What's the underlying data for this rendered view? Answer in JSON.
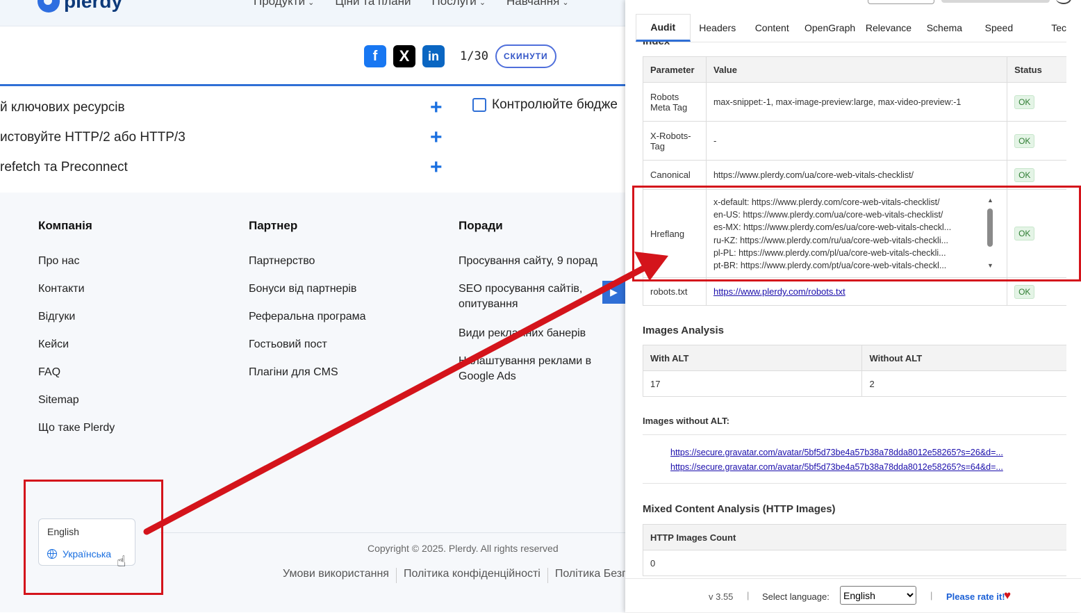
{
  "site": {
    "logo_text": "plerdy",
    "nav": [
      "Продукти",
      "Ціни та плани",
      "Послуги",
      "Навчання"
    ],
    "share": {
      "counter": "1/30",
      "reset_label": "СКИНУТИ",
      "fb_icon": "f",
      "x_icon": "X",
      "li_icon": "in"
    },
    "checklist": [
      "й ключових ресурсів",
      "истовуйте HTTP/2 або HTTP/3",
      "refetch та Preconnect"
    ],
    "checklist_right": "Контролюйте бюдже",
    "footer": {
      "columns": [
        {
          "title": "Компанія",
          "links": [
            "Про нас",
            "Контакти",
            "Відгуки",
            "Кейси",
            "FAQ",
            "Sitemap",
            "Що таке Plerdy"
          ]
        },
        {
          "title": "Партнер",
          "links": [
            "Партнерство",
            "Бонуси від партнерів",
            "Реферальна програма",
            "Гостьовий пост",
            "Плагіни для CMS"
          ]
        },
        {
          "title": "Поради",
          "links": [
            "Просування сайту, 9 порад",
            "SEO просування сайтів, опитування",
            "Види рекламних банерів",
            "Налаштування реклами в Google Ads"
          ]
        }
      ],
      "lang_options": [
        "English",
        "Українська"
      ],
      "copyright": "Copyright © 2025. Plerdy. All rights reserved",
      "legal": [
        "Умови використання",
        "Політика конфіденційності",
        "Політика Безп"
      ]
    }
  },
  "panel": {
    "tabs": [
      "Audit",
      "Headers",
      "Content",
      "OpenGraph",
      "Relevance",
      "Schema",
      "Speed",
      "Tec"
    ],
    "active_tab": "Audit",
    "clipped_heading": "Index",
    "index_table": {
      "headers": [
        "Parameter",
        "Value",
        "Status"
      ],
      "rows": [
        {
          "param": "Robots Meta Tag",
          "value": "max-snippet:-1, max-image-preview:large, max-video-preview:-1",
          "status": "OK"
        },
        {
          "param": "X-Robots-Tag",
          "value": "-",
          "status": "OK"
        },
        {
          "param": "Canonical",
          "value": "https://www.plerdy.com/ua/core-web-vitals-checklist/",
          "status": "OK"
        },
        {
          "param": "Hreflang",
          "values": [
            "x-default: https://www.plerdy.com/core-web-vitals-checklist/",
            "en-US: https://www.plerdy.com/ua/core-web-vitals-checklist/",
            "es-MX: https://www.plerdy.com/es/ua/core-web-vitals-checkl...",
            "ru-KZ: https://www.plerdy.com/ru/ua/core-web-vitals-checkli...",
            "pl-PL: https://www.plerdy.com/pl/ua/core-web-vitals-checkli...",
            "pt-BR: https://www.plerdy.com/pt/ua/core-web-vitals-checkl..."
          ],
          "status": "OK"
        },
        {
          "param": "robots.txt",
          "value": "https://www.plerdy.com/robots.txt",
          "status": "OK"
        }
      ]
    },
    "images": {
      "title": "Images Analysis",
      "headers": [
        "With ALT",
        "Without ALT"
      ],
      "values": [
        "17",
        "2"
      ],
      "without_alt_title": "Images without ALT:",
      "without_alt_links": [
        "https://secure.gravatar.com/avatar/5bf5d73be4a57b38a78dda8012e58265?s=26&d=...",
        "https://secure.gravatar.com/avatar/5bf5d73be4a57b38a78dda8012e58265?s=64&d=..."
      ]
    },
    "mixed": {
      "title": "Mixed Content Analysis (HTTP Images)",
      "header": "HTTP Images Count",
      "value": "0"
    },
    "footer": {
      "version": "v 3.55",
      "sep": "|",
      "lang_label": "Select language:",
      "lang_value": "English",
      "rate": "Please rate it!",
      "heart_icon": "♥"
    }
  },
  "colors": {
    "accent": "#2f6fd6",
    "annotation": "#d4141b",
    "ok_bg": "#e4f4e6",
    "ok_text": "#2e7d32"
  }
}
